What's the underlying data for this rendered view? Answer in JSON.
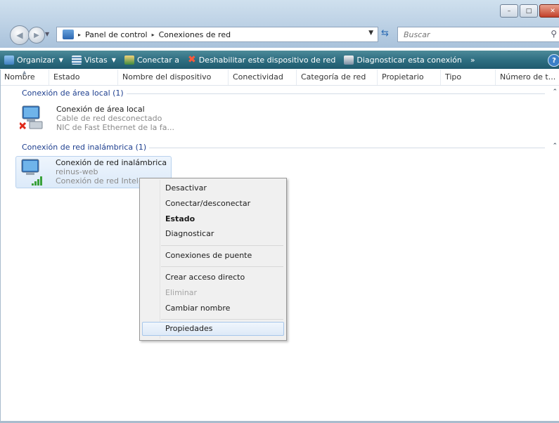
{
  "window": {
    "buttons": {
      "minimize": "–",
      "maximize": "□",
      "close": "✕"
    }
  },
  "nav": {
    "back_glyph": "◀",
    "forward_glyph": "▶",
    "breadcrumb": [
      "Panel de control",
      "Conexiones de red"
    ],
    "breadcrumb_sep": "▸",
    "search_placeholder": "Buscar"
  },
  "toolbar": {
    "organize": "Organizar",
    "views": "Vistas",
    "connect": "Conectar a",
    "disable": "Deshabilitar este dispositivo de red",
    "diagnose": "Diagnosticar esta conexión",
    "more": "»",
    "help": "?",
    "colors": {
      "bar": "#2f6f82",
      "text": "#ffffff"
    }
  },
  "columns": [
    "Nombre",
    "Estado",
    "Nombre del dispositivo",
    "Conectividad",
    "Categoría de red",
    "Propietario",
    "Tipo",
    "Número de t..."
  ],
  "groups": [
    {
      "label": "Conexión de área local (1)",
      "toggle": "⌃"
    },
    {
      "label": "Conexión de red inalámbrica (1)",
      "toggle": "⌃"
    }
  ],
  "items": [
    {
      "title": "Conexión de área local",
      "line2": "Cable de red desconectado",
      "line3": "NIC de Fast Ethernet de la fa..."
    },
    {
      "title": "Conexión de red inalámbrica",
      "line2": "reinus-web",
      "line3": "Conexión de red Intel(R..."
    }
  ],
  "context_menu": {
    "deactivate": "Desactivar",
    "connect_disconnect": "Conectar/desconectar",
    "status": "Estado",
    "diagnose": "Diagnosticar",
    "bridge": "Conexiones de puente",
    "shortcut": "Crear acceso directo",
    "delete": "Eliminar",
    "rename": "Cambiar nombre",
    "properties": "Propiedades"
  }
}
